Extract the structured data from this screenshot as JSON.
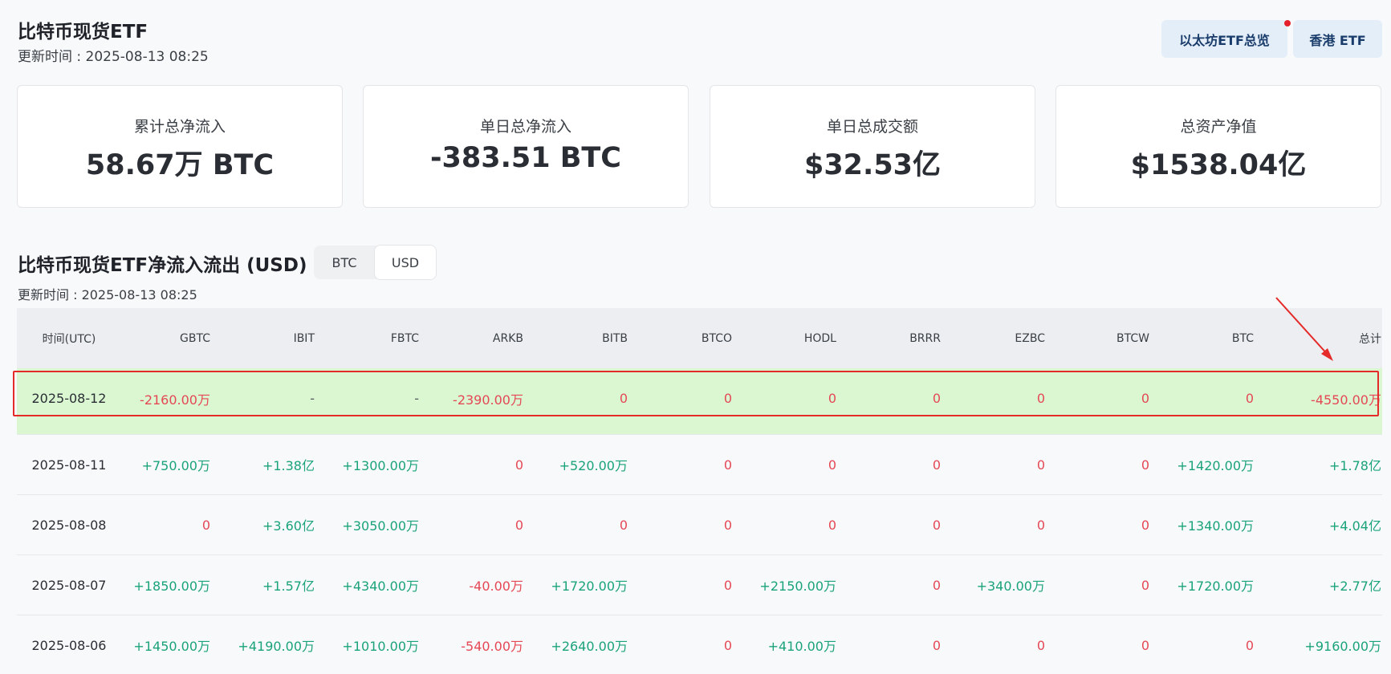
{
  "header": {
    "title": "比特币现货ETF",
    "update_time": "更新时间 : 2025-08-13 08:25",
    "buttons": {
      "eth": "以太坊ETF总览",
      "hk": "香港 ETF"
    }
  },
  "cards": [
    {
      "label": "累计总净流入",
      "value": "58.67万 BTC"
    },
    {
      "label": "单日总净流入",
      "value": "-383.51 BTC"
    },
    {
      "label": "单日总成交额",
      "value": "$32.53亿"
    },
    {
      "label": "总资产净值",
      "value": "$1538.04亿"
    }
  ],
  "section": {
    "title": "比特币现货ETF净流入流出 (USD)",
    "toggle": {
      "btc": "BTC",
      "usd": "USD",
      "selected": "USD"
    },
    "update_time": "更新时间 : 2025-08-13 08:25"
  },
  "table": {
    "columns": [
      "时间(UTC)",
      "GBTC",
      "IBIT",
      "FBTC",
      "ARKB",
      "BITB",
      "BTCO",
      "HODL",
      "BRRR",
      "EZBC",
      "BTCW",
      "BTC",
      "总计"
    ],
    "rows": [
      {
        "highlight": true,
        "cells": [
          "2025-08-12",
          "-2160.00万",
          "-",
          "-",
          "-2390.00万",
          "0",
          "0",
          "0",
          "0",
          "0",
          "0",
          "0",
          "-4550.00万"
        ]
      },
      {
        "highlight": false,
        "cells": [
          "2025-08-11",
          "+750.00万",
          "+1.38亿",
          "+1300.00万",
          "0",
          "+520.00万",
          "0",
          "0",
          "0",
          "0",
          "0",
          "+1420.00万",
          "+1.78亿"
        ]
      },
      {
        "highlight": false,
        "cells": [
          "2025-08-08",
          "0",
          "+3.60亿",
          "+3050.00万",
          "0",
          "0",
          "0",
          "0",
          "0",
          "0",
          "0",
          "+1340.00万",
          "+4.04亿"
        ]
      },
      {
        "highlight": false,
        "cells": [
          "2025-08-07",
          "+1850.00万",
          "+1.57亿",
          "+4340.00万",
          "-40.00万",
          "+1720.00万",
          "0",
          "+2150.00万",
          "0",
          "+340.00万",
          "0",
          "+1720.00万",
          "+2.77亿"
        ]
      },
      {
        "highlight": false,
        "cells": [
          "2025-08-06",
          "+1450.00万",
          "+4190.00万",
          "+1010.00万",
          "-540.00万",
          "+2640.00万",
          "0",
          "+410.00万",
          "0",
          "0",
          "0",
          "0",
          "+9160.00万"
        ]
      }
    ]
  },
  "colors": {
    "positive": "#1aa37a",
    "negative": "#e54855",
    "highlight_row": "#daf7d2",
    "annotation": "#e52a2a"
  }
}
